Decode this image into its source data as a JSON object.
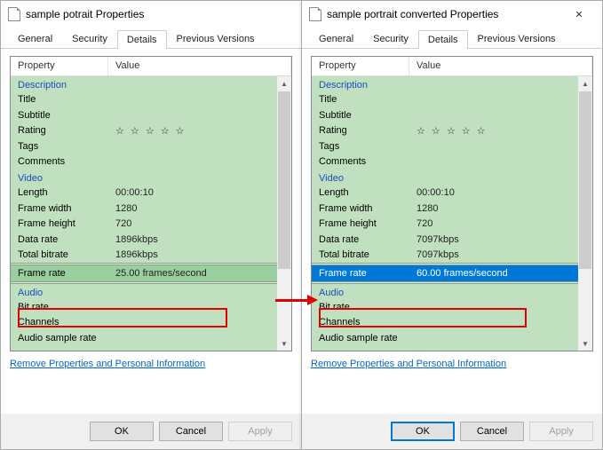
{
  "left": {
    "title": "sample potrait Properties",
    "tabs": [
      "General",
      "Security",
      "Details",
      "Previous Versions"
    ],
    "activeTab": 2,
    "headers": {
      "prop": "Property",
      "val": "Value"
    },
    "groups": {
      "desc": "Description",
      "video": "Video",
      "audio": "Audio"
    },
    "desc_rows": {
      "title": "Title",
      "subtitle": "Subtitle",
      "rating": "Rating",
      "tags": "Tags",
      "comments": "Comments"
    },
    "video_rows": {
      "length_k": "Length",
      "length_v": "00:00:10",
      "fw_k": "Frame width",
      "fw_v": "1280",
      "fh_k": "Frame height",
      "fh_v": "720",
      "dr_k": "Data rate",
      "dr_v": "1896kbps",
      "tb_k": "Total bitrate",
      "tb_v": "1896kbps",
      "fr_k": "Frame rate",
      "fr_v": "25.00 frames/second"
    },
    "audio_rows": {
      "br": "Bit rate",
      "ch": "Channels",
      "asr": "Audio sample rate"
    },
    "link": "Remove Properties and Personal Information",
    "buttons": {
      "ok": "OK",
      "cancel": "Cancel",
      "apply": "Apply"
    },
    "stars": "☆ ☆ ☆ ☆ ☆"
  },
  "right": {
    "title": "sample portrait converted Properties",
    "tabs": [
      "General",
      "Security",
      "Details",
      "Previous Versions"
    ],
    "activeTab": 2,
    "headers": {
      "prop": "Property",
      "val": "Value"
    },
    "groups": {
      "desc": "Description",
      "video": "Video",
      "audio": "Audio"
    },
    "desc_rows": {
      "title": "Title",
      "subtitle": "Subtitle",
      "rating": "Rating",
      "tags": "Tags",
      "comments": "Comments"
    },
    "video_rows": {
      "length_k": "Length",
      "length_v": "00:00:10",
      "fw_k": "Frame width",
      "fw_v": "1280",
      "fh_k": "Frame height",
      "fh_v": "720",
      "dr_k": "Data rate",
      "dr_v": "7097kbps",
      "tb_k": "Total bitrate",
      "tb_v": "7097kbps",
      "fr_k": "Frame rate",
      "fr_v": "60.00 frames/second"
    },
    "audio_rows": {
      "br": "Bit rate",
      "ch": "Channels",
      "asr": "Audio sample rate"
    },
    "link": "Remove Properties and Personal Information",
    "buttons": {
      "ok": "OK",
      "cancel": "Cancel",
      "apply": "Apply"
    },
    "stars": "☆ ☆ ☆ ☆ ☆"
  }
}
